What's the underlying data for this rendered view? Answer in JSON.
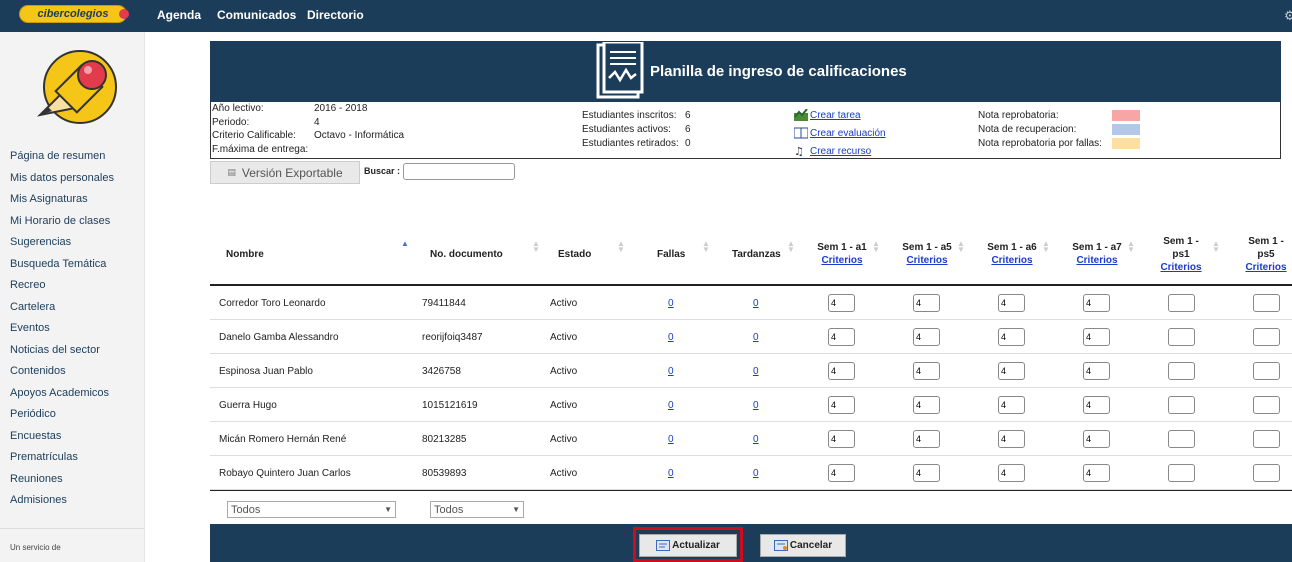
{
  "topbar": {
    "logo": "cibercolegios",
    "nav": [
      "Agenda",
      "Comunicados",
      "Directorio"
    ]
  },
  "sidebar": {
    "items": [
      "Página de resumen",
      "Mis datos personales",
      "Mis Asignaturas",
      "Mi Horario de clases",
      "Sugerencias",
      "Busqueda Temática",
      "Recreo",
      "Cartelera",
      "Eventos",
      "Noticias del sector",
      "Contenidos",
      "Apoyos Academicos",
      "Periódico",
      "Encuestas",
      "Prematrículas",
      "Reuniones",
      "Admisiones"
    ],
    "footer": "Un servicio de"
  },
  "header": {
    "title": "Planilla de ingreso de calificaciones"
  },
  "info": {
    "labels": [
      "Año lectivo:",
      "Periodo:",
      "Criterio Calificable:",
      "F.máxima de entrega:"
    ],
    "values": [
      "2016 - 2018",
      "4",
      "Octavo - Informática",
      ""
    ],
    "stats_labels": [
      "Estudiantes inscritos:",
      "Estudiantes activos:",
      "Estudiantes retirados:"
    ],
    "stats_values": [
      "6",
      "6",
      "0"
    ],
    "links": [
      "Crear tarea",
      "Crear evaluación",
      "Crear recurso"
    ],
    "legend": [
      "Nota reprobatoria:",
      "Nota de recuperacion:",
      "Nota reprobatoria por fallas:"
    ],
    "legend_colors": [
      "#f8a5a5",
      "#b3c8e8",
      "#fde09f"
    ]
  },
  "toolbar": {
    "export_label": "Versión Exportable",
    "search_label": "Buscar :",
    "search_value": ""
  },
  "table": {
    "headers": {
      "nombre": "Nombre",
      "documento": "No. documento",
      "estado": "Estado",
      "fallas": "Fallas",
      "tardanzas": "Tardanzas",
      "sem": [
        {
          "title": "Sem 1 - a1",
          "link": "Criterios"
        },
        {
          "title": "Sem 1 - a5",
          "link": "Criterios"
        },
        {
          "title": "Sem 1 - a6",
          "link": "Criterios"
        },
        {
          "title": "Sem 1 - a7",
          "link": "Criterios"
        },
        {
          "title": "Sem 1 -",
          "title2": "ps1",
          "link": "Criterios"
        },
        {
          "title": "Sem 1 -",
          "title2": "ps5",
          "link": "Criterios"
        }
      ]
    },
    "rows": [
      {
        "nombre": "Corredor Toro Leonardo",
        "doc": "79411844",
        "estado": "Activo",
        "fallas": "0",
        "tardanzas": "0",
        "g": [
          "4",
          "4",
          "4",
          "4",
          "",
          ""
        ]
      },
      {
        "nombre": "Danelo Gamba Alessandro",
        "doc": "reorijfoiq3487",
        "estado": "Activo",
        "fallas": "0",
        "tardanzas": "0",
        "g": [
          "4",
          "4",
          "4",
          "4",
          "",
          ""
        ]
      },
      {
        "nombre": "Espinosa Juan Pablo",
        "doc": "3426758",
        "estado": "Activo",
        "fallas": "0",
        "tardanzas": "0",
        "g": [
          "4",
          "4",
          "4",
          "4",
          "",
          ""
        ]
      },
      {
        "nombre": "Guerra Hugo",
        "doc": "1015121619",
        "estado": "Activo",
        "fallas": "0",
        "tardanzas": "0",
        "g": [
          "4",
          "4",
          "4",
          "4",
          "",
          ""
        ]
      },
      {
        "nombre": "Micán Romero Hernán René",
        "doc": "80213285",
        "estado": "Activo",
        "fallas": "0",
        "tardanzas": "0",
        "g": [
          "4",
          "4",
          "4",
          "4",
          "",
          ""
        ]
      },
      {
        "nombre": "Robayo Quintero Juan Carlos",
        "doc": "80539893",
        "estado": "Activo",
        "fallas": "0",
        "tardanzas": "0",
        "g": [
          "4",
          "4",
          "4",
          "4",
          "",
          ""
        ]
      }
    ],
    "filters": [
      "Todos",
      "Todos"
    ]
  },
  "actions": {
    "update": "Actualizar",
    "cancel": "Cancelar"
  },
  "colors": {
    "brand": "#1c3d5a",
    "link": "#1a3cc8",
    "highlight": "#d10b1e"
  }
}
